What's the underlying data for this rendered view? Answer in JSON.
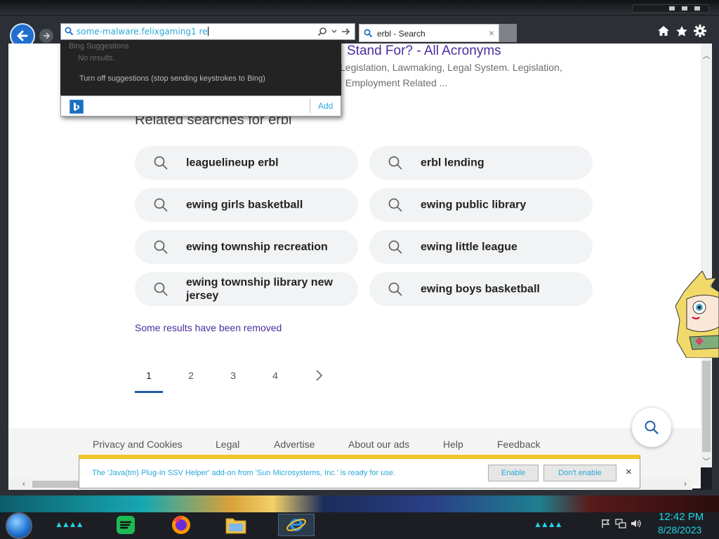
{
  "browser": {
    "address_text": "some-malware.felixgaming1 re",
    "tab_title": "erbl - Search",
    "tab_close": "×"
  },
  "suggestions": {
    "header": "Bing Suggestions",
    "no_results": "No results.",
    "turn_off": "Turn off suggestions (stop sending keystrokes to Bing)",
    "add_label": "Add"
  },
  "result": {
    "title": "Stand For? - All Acronyms",
    "snippet_line1": "Legislation, Lawmaking, Legal System. Legislation,",
    "snippet_line2": ". Employment Related ..."
  },
  "related": {
    "heading": "Related searches for erbl",
    "items": [
      "leaguelineup erbl",
      "erbl lending",
      "ewing girls basketball",
      "ewing public library",
      "ewing township recreation",
      "ewing little league",
      "ewing township library new jersey",
      "ewing boys basketball"
    ]
  },
  "removed_notice": "Some results have been removed",
  "pagination": {
    "pages": [
      "1",
      "2",
      "3",
      "4"
    ],
    "current": "1"
  },
  "footer": {
    "links": [
      "Privacy and Cookies",
      "Legal",
      "Advertise",
      "About our ads",
      "Help",
      "Feedback"
    ]
  },
  "notification": {
    "message": "The 'Java(tm) Plug-In SSV Helper' add-on from 'Sun Microsystems, Inc.' is ready for use.",
    "enable_label": "Enable",
    "dont_enable_label": "Don't enable",
    "close": "×"
  },
  "taskbar": {
    "time": "12:42 PM",
    "date": "8/28/2023",
    "apps": [
      "spotify-icon",
      "firefox-icon",
      "file-explorer-icon",
      "internet-explorer-icon"
    ]
  },
  "colors": {
    "link_purple": "#4b2c9e",
    "accent_cyan": "#2aa7d8",
    "pager_active": "#1e5aa8",
    "notif_yellow": "#f2c428",
    "clock_cyan": "#21d4e8"
  }
}
